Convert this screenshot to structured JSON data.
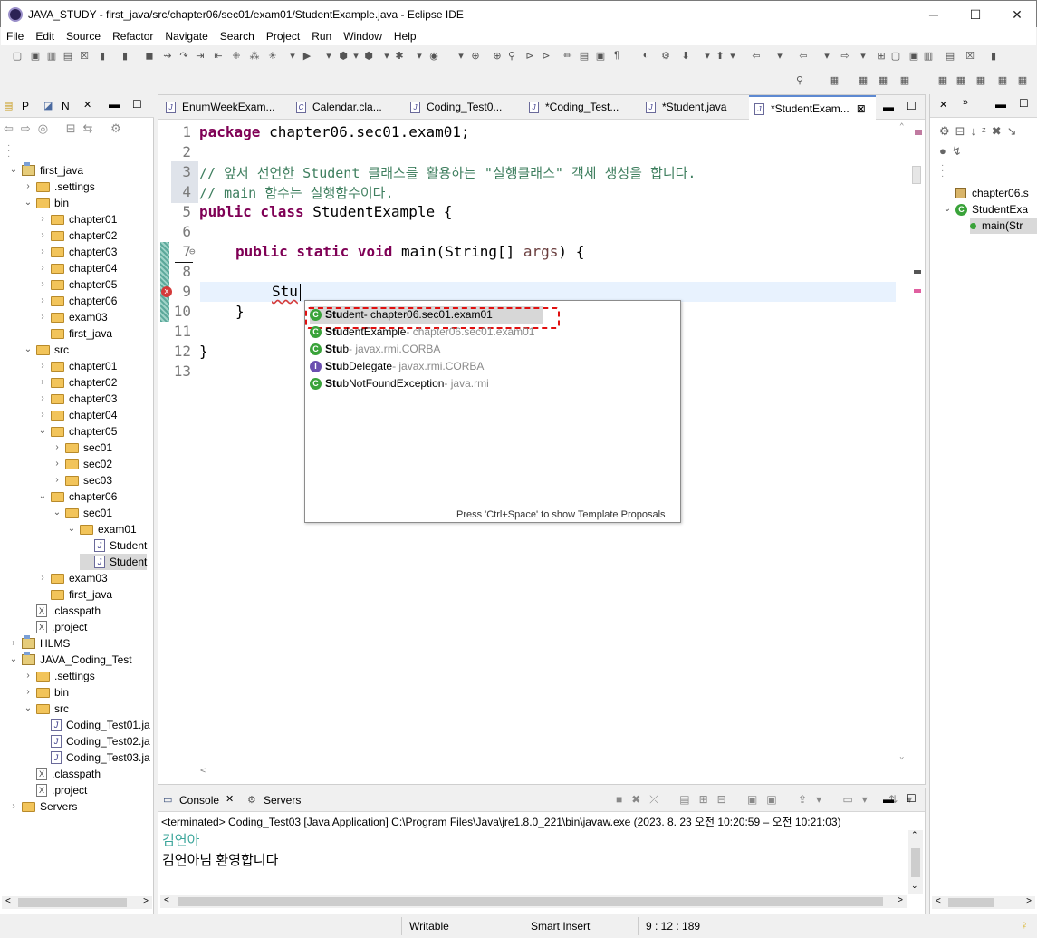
{
  "window": {
    "title": "JAVA_STUDY - first_java/src/chapter06/sec01/exam01/StudentExample.java - Eclipse IDE"
  },
  "menu": [
    "File",
    "Edit",
    "Source",
    "Refactor",
    "Navigate",
    "Search",
    "Project",
    "Run",
    "Window",
    "Help"
  ],
  "left_tabs": {
    "tab1": "P",
    "tab2": "N"
  },
  "tree": [
    {
      "label": "first_java",
      "depth": 0,
      "twisty": "v",
      "icon": "project"
    },
    {
      "label": ".settings",
      "depth": 1,
      "twisty": ">",
      "icon": "folder"
    },
    {
      "label": "bin",
      "depth": 1,
      "twisty": "v",
      "icon": "folder"
    },
    {
      "label": "chapter01",
      "depth": 2,
      "twisty": ">",
      "icon": "folder"
    },
    {
      "label": "chapter02",
      "depth": 2,
      "twisty": ">",
      "icon": "folder"
    },
    {
      "label": "chapter03",
      "depth": 2,
      "twisty": ">",
      "icon": "folder"
    },
    {
      "label": "chapter04",
      "depth": 2,
      "twisty": ">",
      "icon": "folder"
    },
    {
      "label": "chapter05",
      "depth": 2,
      "twisty": ">",
      "icon": "folder"
    },
    {
      "label": "chapter06",
      "depth": 2,
      "twisty": ">",
      "icon": "folder"
    },
    {
      "label": "exam03",
      "depth": 2,
      "twisty": ">",
      "icon": "folder"
    },
    {
      "label": "first_java",
      "depth": 2,
      "twisty": "",
      "icon": "folder"
    },
    {
      "label": "src",
      "depth": 1,
      "twisty": "v",
      "icon": "folder"
    },
    {
      "label": "chapter01",
      "depth": 2,
      "twisty": ">",
      "icon": "folder"
    },
    {
      "label": "chapter02",
      "depth": 2,
      "twisty": ">",
      "icon": "folder"
    },
    {
      "label": "chapter03",
      "depth": 2,
      "twisty": ">",
      "icon": "folder"
    },
    {
      "label": "chapter04",
      "depth": 2,
      "twisty": ">",
      "icon": "folder"
    },
    {
      "label": "chapter05",
      "depth": 2,
      "twisty": "v",
      "icon": "folder"
    },
    {
      "label": "sec01",
      "depth": 3,
      "twisty": ">",
      "icon": "folder"
    },
    {
      "label": "sec02",
      "depth": 3,
      "twisty": ">",
      "icon": "folder"
    },
    {
      "label": "sec03",
      "depth": 3,
      "twisty": ">",
      "icon": "folder"
    },
    {
      "label": "chapter06",
      "depth": 2,
      "twisty": "v",
      "icon": "folder"
    },
    {
      "label": "sec01",
      "depth": 3,
      "twisty": "v",
      "icon": "folder"
    },
    {
      "label": "exam01",
      "depth": 4,
      "twisty": "v",
      "icon": "folder"
    },
    {
      "label": "Student",
      "depth": 5,
      "twisty": "",
      "icon": "java"
    },
    {
      "label": "Student",
      "depth": 5,
      "twisty": "",
      "icon": "java",
      "selected": true
    },
    {
      "label": "exam03",
      "depth": 2,
      "twisty": ">",
      "icon": "folder"
    },
    {
      "label": "first_java",
      "depth": 2,
      "twisty": "",
      "icon": "folder"
    },
    {
      "label": ".classpath",
      "depth": 1,
      "twisty": "",
      "icon": "xml"
    },
    {
      "label": ".project",
      "depth": 1,
      "twisty": "",
      "icon": "xml"
    },
    {
      "label": "HLMS",
      "depth": 0,
      "twisty": ">",
      "icon": "project"
    },
    {
      "label": "JAVA_Coding_Test",
      "depth": 0,
      "twisty": "v",
      "icon": "project"
    },
    {
      "label": ".settings",
      "depth": 1,
      "twisty": ">",
      "icon": "folder"
    },
    {
      "label": "bin",
      "depth": 1,
      "twisty": ">",
      "icon": "folder"
    },
    {
      "label": "src",
      "depth": 1,
      "twisty": "v",
      "icon": "folder"
    },
    {
      "label": "Coding_Test01.ja",
      "depth": 2,
      "twisty": "",
      "icon": "java"
    },
    {
      "label": "Coding_Test02.ja",
      "depth": 2,
      "twisty": "",
      "icon": "java"
    },
    {
      "label": "Coding_Test03.ja",
      "depth": 2,
      "twisty": "",
      "icon": "java"
    },
    {
      "label": ".classpath",
      "depth": 1,
      "twisty": "",
      "icon": "xml"
    },
    {
      "label": ".project",
      "depth": 1,
      "twisty": "",
      "icon": "xml"
    },
    {
      "label": "Servers",
      "depth": 0,
      "twisty": ">",
      "icon": "folder"
    }
  ],
  "editor_tabs": [
    {
      "label": "EnumWeekExam..."
    },
    {
      "label": "Calendar.cla..."
    },
    {
      "label": "Coding_Test0..."
    },
    {
      "label": "*Coding_Test..."
    },
    {
      "label": "*Student.java"
    },
    {
      "label": "*StudentExam...",
      "close": "⊠"
    }
  ],
  "code": {
    "line_numbers": [
      "1",
      "2",
      "3",
      "4",
      "5",
      "6",
      "7",
      "8",
      "9",
      "10",
      "11",
      "12",
      "13"
    ],
    "l1_kw": "package",
    "l1_rest": " chapter06.sec01.exam01;",
    "l3": "// 앞서 선언한 Student 클래스를 활용하는 \"실행클래스\" 객체 생성을 합니다.",
    "l4": "// main 함수는 실행함수이다.",
    "l5_kw": "public class",
    "l5_rest": " StudentExample {",
    "l7_kw": "public static void",
    "l7_rest": " main(String[] ",
    "l7_arg": "args",
    "l7_end": ") {",
    "l9": "Stu",
    "l10": "}",
    "l12": "}"
  },
  "autocomplete": {
    "items": [
      {
        "bold": "Stu",
        "name": "dent",
        "pkg": " - chapter06.sec01.exam01",
        "icon": "C"
      },
      {
        "bold": "Stu",
        "name": "dentExample",
        "pkg": " - chapter06.sec01.exam01",
        "icon": "C"
      },
      {
        "bold": "Stu",
        "name": "b",
        "pkg": " - javax.rmi.CORBA",
        "icon": "C"
      },
      {
        "bold": "Stu",
        "name": "bDelegate",
        "pkg": " - javax.rmi.CORBA",
        "icon": "I"
      },
      {
        "bold": "Stu",
        "name": "bNotFoundException",
        "pkg": " - java.rmi",
        "icon": "C"
      }
    ],
    "hint": "Press 'Ctrl+Space' to show Template Proposals"
  },
  "console": {
    "tab1": "Console",
    "tab2": "Servers",
    "header": "<terminated> Coding_Test03 [Java Application] C:\\Program Files\\Java\\jre1.8.0_221\\bin\\javaw.exe  (2023. 8. 23 오전 10:20:59 – 오전 10:21:03)",
    "line1": "김연아",
    "line2": "김연아님 환영합니다"
  },
  "outline": {
    "items": [
      {
        "label": "chapter06.s"
      },
      {
        "label": "StudentExa"
      },
      {
        "label": "main(Str"
      }
    ]
  },
  "status": {
    "writable": "Writable",
    "insert": "Smart Insert",
    "pos": "9 : 12 : 189"
  },
  "colors": {
    "keyword": "#7f0055",
    "comment": "#3f7f5f",
    "current_line": "#e8f2fe",
    "highlight_border": "#e01010"
  }
}
